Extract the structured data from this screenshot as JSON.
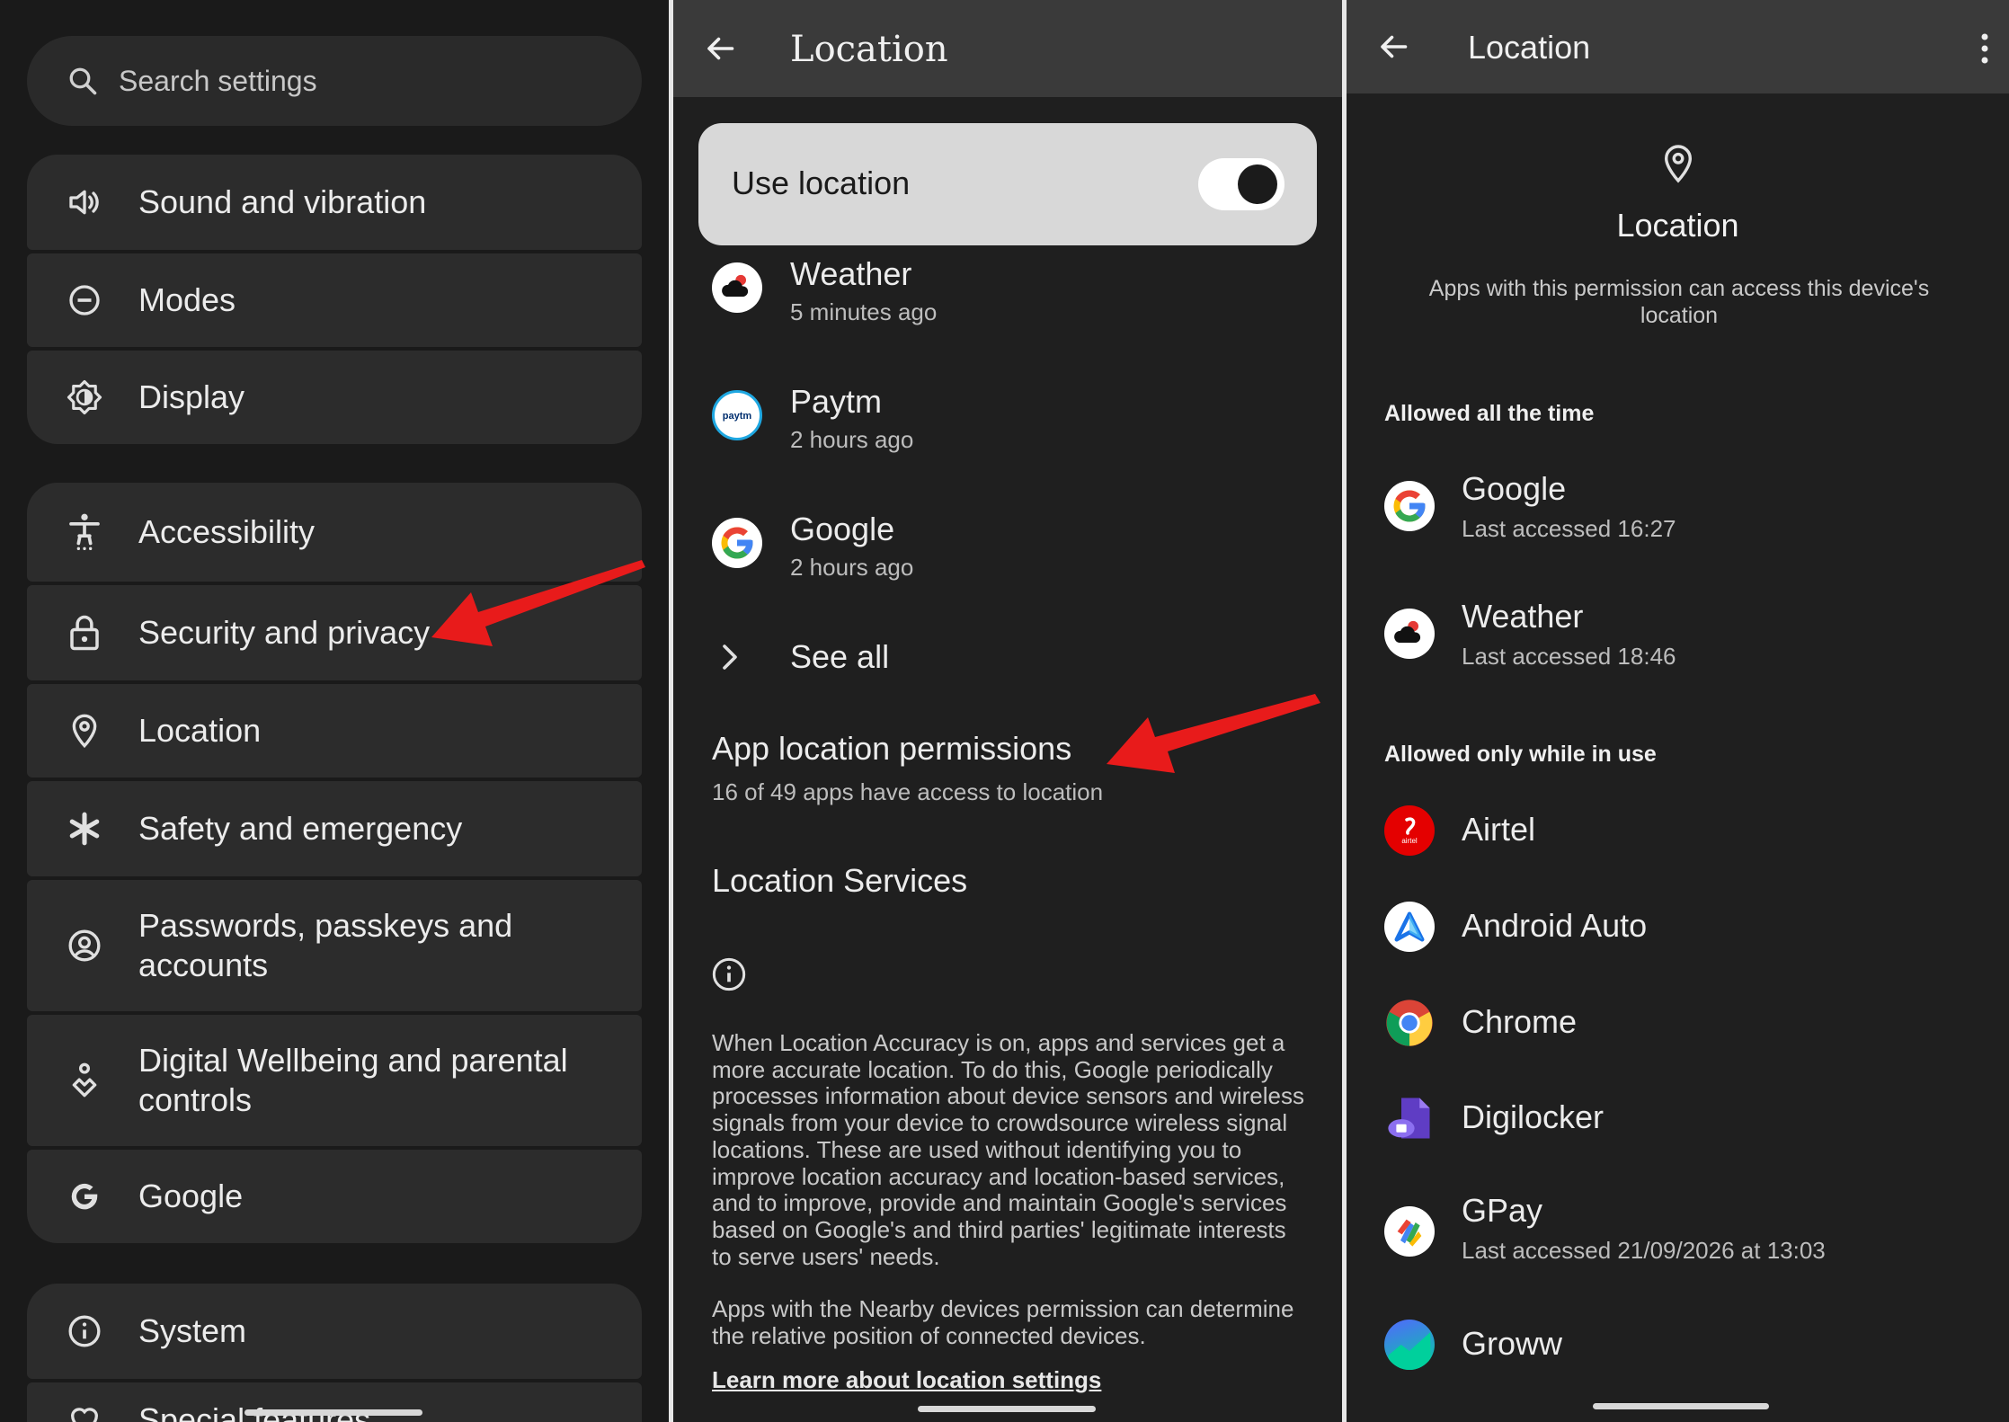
{
  "screen1": {
    "search_placeholder": "Search settings",
    "items": [
      {
        "label": "Sound and vibration",
        "icon": "volume-icon"
      },
      {
        "label": "Modes",
        "icon": "modes-icon"
      },
      {
        "label": "Display",
        "icon": "brightness-icon"
      },
      {
        "label": "Accessibility",
        "icon": "accessibility-icon"
      },
      {
        "label": "Security and privacy",
        "icon": "lock-icon"
      },
      {
        "label": "Location",
        "icon": "location-pin-icon"
      },
      {
        "label": "Safety and emergency",
        "icon": "asterisk-icon"
      },
      {
        "label": "Passwords, passkeys and accounts",
        "icon": "account-circle-icon"
      },
      {
        "label": "Digital Wellbeing and parental controls",
        "icon": "wellbeing-icon"
      },
      {
        "label": "Google",
        "icon": "google-g-icon"
      },
      {
        "label": "System",
        "icon": "info-icon"
      },
      {
        "label": "Special features",
        "icon": "special-icon"
      }
    ]
  },
  "screen2": {
    "title": "Location",
    "use_location_label": "Use location",
    "use_location_on": true,
    "recent": [
      {
        "name": "Weather",
        "time": "5 minutes ago",
        "icon": "weather-icon"
      },
      {
        "name": "Paytm",
        "time": "2 hours ago",
        "icon": "paytm-icon"
      },
      {
        "name": "Google",
        "time": "2 hours ago",
        "icon": "google-icon"
      }
    ],
    "see_all": "See all",
    "app_perm_title": "App location permissions",
    "app_perm_sub": "16 of 49 apps have access to location",
    "services_title": "Location Services",
    "info_text": "When Location Accuracy is on, apps and services get a more accurate location. To do this, Google periodically processes information about device sensors and wireless signals from your device to crowdsource wireless signal locations. These are used without identifying you to improve location accuracy and location-based services, and to improve, provide and maintain Google's services based on Google's and third parties' legitimate interests to serve users' needs.",
    "nearby_text": "Apps with the Nearby devices permission can determine the relative position of connected devices.",
    "learn_more": "Learn more about location settings"
  },
  "screen3": {
    "title": "Location",
    "header_title": "Location",
    "header_desc": "Apps with this permission can access this device's location",
    "section_always": "Allowed all the time",
    "always": [
      {
        "name": "Google",
        "sub": "Last accessed 16:27",
        "icon": "google-icon"
      },
      {
        "name": "Weather",
        "sub": "Last accessed 18:46",
        "icon": "weather-icon"
      }
    ],
    "section_in_use": "Allowed only while in use",
    "in_use": [
      {
        "name": "Airtel",
        "sub": "",
        "icon": "airtel-icon"
      },
      {
        "name": "Android Auto",
        "sub": "",
        "icon": "android-auto-icon"
      },
      {
        "name": "Chrome",
        "sub": "",
        "icon": "chrome-icon"
      },
      {
        "name": "Digilocker",
        "sub": "",
        "icon": "digilocker-icon"
      },
      {
        "name": "GPay",
        "sub": "Last accessed 21/09/2026 at 13:03",
        "icon": "gpay-icon"
      },
      {
        "name": "Groww",
        "sub": "",
        "icon": "groww-icon"
      }
    ]
  },
  "colors": {
    "accent_arrow": "#e81b1b",
    "background": "#1f1f1f",
    "appbar": "#3a3a3a"
  }
}
